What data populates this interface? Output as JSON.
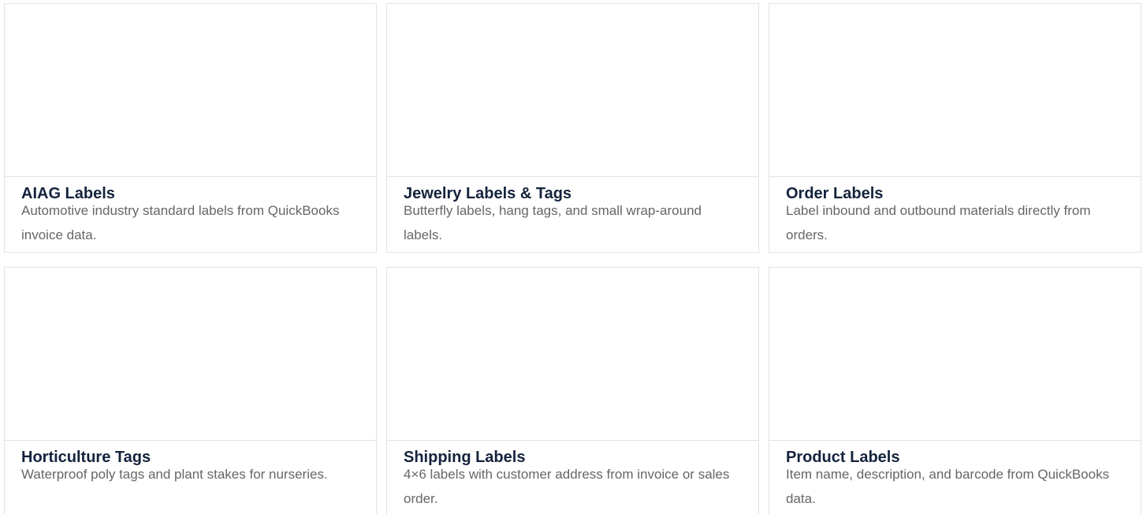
{
  "cards": [
    {
      "title": "AIAG Labels",
      "description": "Automotive industry standard labels from QuickBooks invoice data."
    },
    {
      "title": "Jewelry Labels & Tags",
      "description": "Butterfly labels, hang tags, and small wrap-around labels."
    },
    {
      "title": "Order Labels",
      "description": "Label inbound and outbound materials directly from orders."
    },
    {
      "title": "Horticulture Tags",
      "description": "Waterproof poly tags and plant stakes for nurseries."
    },
    {
      "title": "Shipping Labels",
      "description": "4×6 labels with customer address from invoice or sales order."
    },
    {
      "title": "Product Labels",
      "description": "Item name, description, and barcode from QuickBooks data."
    }
  ]
}
